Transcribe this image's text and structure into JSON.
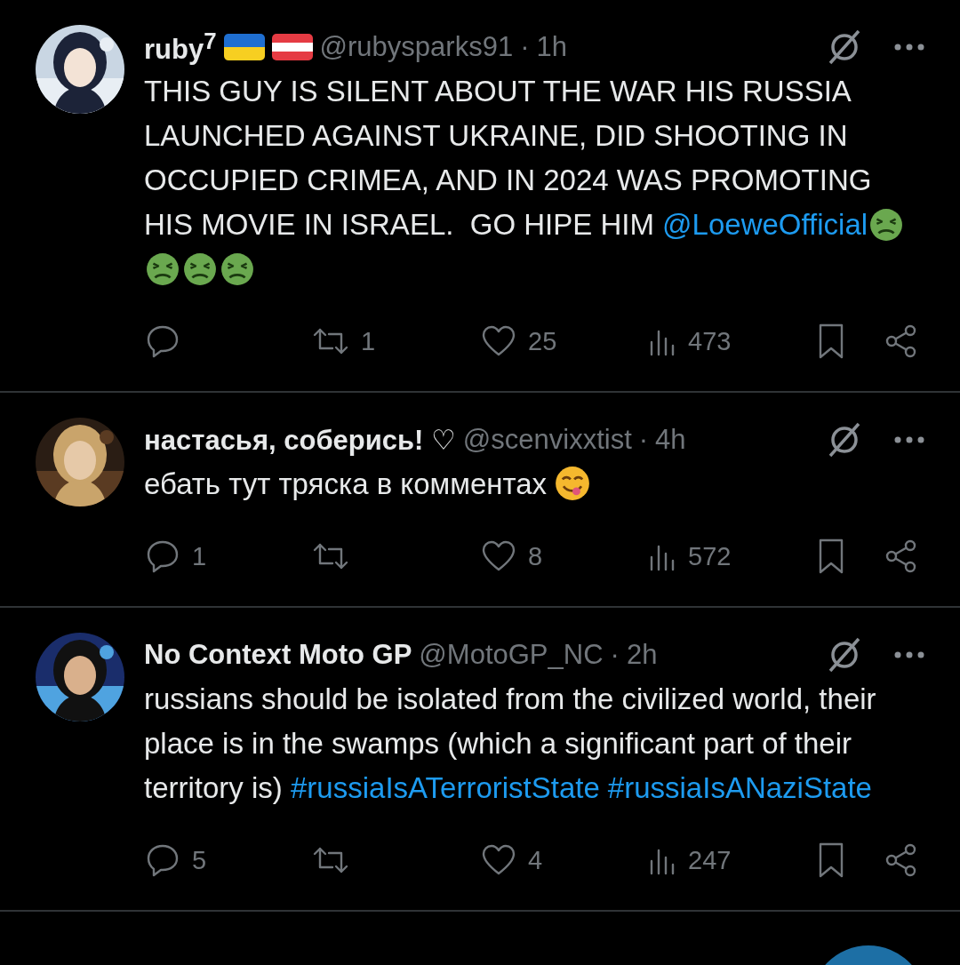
{
  "posts": [
    {
      "name": "ruby$^{7}$",
      "badges": [
        {
          "kind": "flag-ukraine"
        },
        {
          "kind": "flag-austria"
        }
      ],
      "handle": "@rubysparks91",
      "separator": "·",
      "time": "1h",
      "avatar": {
        "kind": "picture"
      },
      "body": [
        {
          "kind": "text",
          "text": "THIS GUY IS SILENT ABOUT THE WAR HIS RUSSIA LAUNCHED AGAINST UKRAINE, DID SHOOTING IN OCCUPIED CRIMEA, AND IN 2024 WAS PROMOTING HIS MOVIE IN ISRAEL.  GO HIPE HIM "
        },
        {
          "kind": "mention",
          "text": "@LoeweOfficial"
        },
        {
          "kind": "nauseated-emoji"
        },
        {
          "kind": "nauseated-emoji"
        },
        {
          "kind": "nauseated-emoji"
        },
        {
          "kind": "nauseated-emoji"
        }
      ],
      "stats": {
        "reposts": "1",
        "likes": "25",
        "views": "473"
      }
    },
    {
      "name": "настасья, соберись! ♡",
      "handle": "@scenvixxtist",
      "separator": "·",
      "time": "4h",
      "avatar": {
        "kind": "picture"
      },
      "body": [
        {
          "kind": "text",
          "text": "ебать тут тряска в комментах "
        },
        {
          "kind": "yum-emoji"
        }
      ],
      "stats": {
        "replies": "1",
        "likes": "8",
        "views": "572"
      }
    },
    {
      "name": "No Context Moto GP",
      "handle": "@MotoGP_NC",
      "separator": "·",
      "time": "2h",
      "avatar": {
        "kind": "picture"
      },
      "body": [
        {
          "kind": "text",
          "text": "russians should be isolated from the civilized world, their place is in the swamps (which a significant part of their territory is) "
        },
        {
          "kind": "hashtag",
          "text": "#russiaIsATerroristState"
        },
        {
          "kind": "hashtag",
          "text": "#russiaIsANaziState"
        }
      ],
      "stats": {
        "replies": "5",
        "likes": "4",
        "views": "247"
      }
    }
  ]
}
